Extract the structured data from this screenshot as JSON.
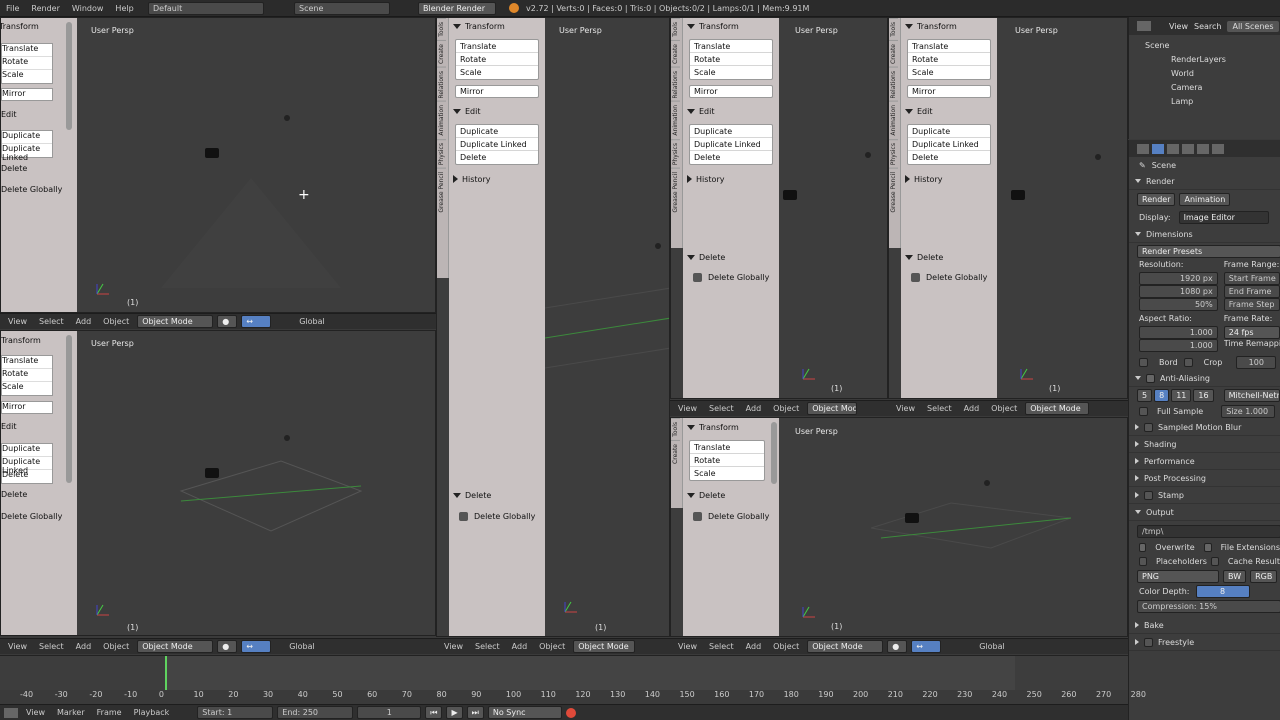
{
  "topbar": {
    "menus": [
      "File",
      "Render",
      "Window",
      "Help"
    ],
    "layout": "Default",
    "scene": "Scene",
    "engine": "Blender Render",
    "stats": "v2.72 | Verts:0 | Faces:0 | Tris:0 | Objects:0/2 | Lamps:0/1 | Mem:9.91M"
  },
  "toolshelf": {
    "transform": "Transform",
    "translate": "Translate",
    "rotate": "Rotate",
    "scale": "Scale",
    "mirror": "Mirror",
    "edit": "Edit",
    "duplicate": "Duplicate",
    "duplicate_linked": "Duplicate Linked",
    "delete": "Delete",
    "history": "History",
    "delete_section": "Delete",
    "delete_globally": "Delete Globally"
  },
  "tooltabs": [
    "Tools",
    "Create",
    "Relations",
    "Animation",
    "Physics",
    "Grease Pencil"
  ],
  "viewport": {
    "title": "User Persp",
    "frame": "(1)"
  },
  "header": {
    "view": "View",
    "select": "Select",
    "add": "Add",
    "object": "Object",
    "mode": "Object Mode",
    "orientation": "Global"
  },
  "outliner": {
    "view": "View",
    "search": "Search",
    "all_scenes": "All Scenes",
    "items": [
      "Scene",
      "RenderLayers",
      "World",
      "Camera",
      "Lamp"
    ]
  },
  "props": {
    "scene": "Scene",
    "render": "Render",
    "render_btn": "Render",
    "animation_btn": "Animation",
    "display_label": "Display:",
    "display_value": "Image Editor",
    "dimensions": "Dimensions",
    "render_presets": "Render Presets",
    "resolution": "Resolution:",
    "res_x": "1920 px",
    "res_y": "1080 px",
    "res_pct": "50%",
    "frame_range": "Frame Range:",
    "start_frame": "Start Frame",
    "end_frame": "End Frame",
    "frame_step": "Frame Step",
    "aspect_ratio": "Aspect Ratio:",
    "asp_x": "1.000",
    "asp_y": "1.000",
    "frame_rate": "Frame Rate:",
    "fps": "24 fps",
    "time_remap": "Time Remapping",
    "remap_val": "100",
    "border": "Bord",
    "crop": "Crop",
    "anti_aliasing": "Anti-Aliasing",
    "aa": [
      "5",
      "8",
      "11",
      "16"
    ],
    "aa_filter": "Mitchell-Netravali",
    "full_sample": "Full Sample",
    "size": "Size",
    "size_val": "1.000",
    "sampled_motion_blur": "Sampled Motion Blur",
    "shading": "Shading",
    "performance": "Performance",
    "post_processing": "Post Processing",
    "stamp": "Stamp",
    "output": "Output",
    "output_path": "/tmp\\",
    "overwrite": "Overwrite",
    "file_ext": "File Extensions",
    "placeholders": "Placeholders",
    "cache_result": "Cache Result",
    "format": "PNG",
    "bw": "BW",
    "rgb": "RGB",
    "color_depth": "Color Depth:",
    "depth_val": "8",
    "compression": "Compression:",
    "compression_val": "15%",
    "bake": "Bake",
    "freestyle": "Freestyle"
  },
  "timeline": {
    "ticks": [
      "-40",
      "-30",
      "-20",
      "-10",
      "0",
      "10",
      "20",
      "30",
      "40",
      "50",
      "60",
      "70",
      "80",
      "90",
      "100",
      "110",
      "120",
      "130",
      "140",
      "150",
      "160",
      "170",
      "180",
      "190",
      "200",
      "210",
      "220",
      "230",
      "240",
      "250",
      "260",
      "270",
      "280"
    ],
    "view": "View",
    "marker": "Marker",
    "frame": "Frame",
    "playback": "Playback",
    "start": "Start:",
    "start_val": "1",
    "end": "End:",
    "end_val": "250",
    "current": "1",
    "sync": "No Sync"
  },
  "colors": {
    "toolshelf_bg": "#c9c2c2",
    "viewport_bg": "#3d3d3d",
    "accent": "#5680c2",
    "orange": "#e0882a"
  }
}
